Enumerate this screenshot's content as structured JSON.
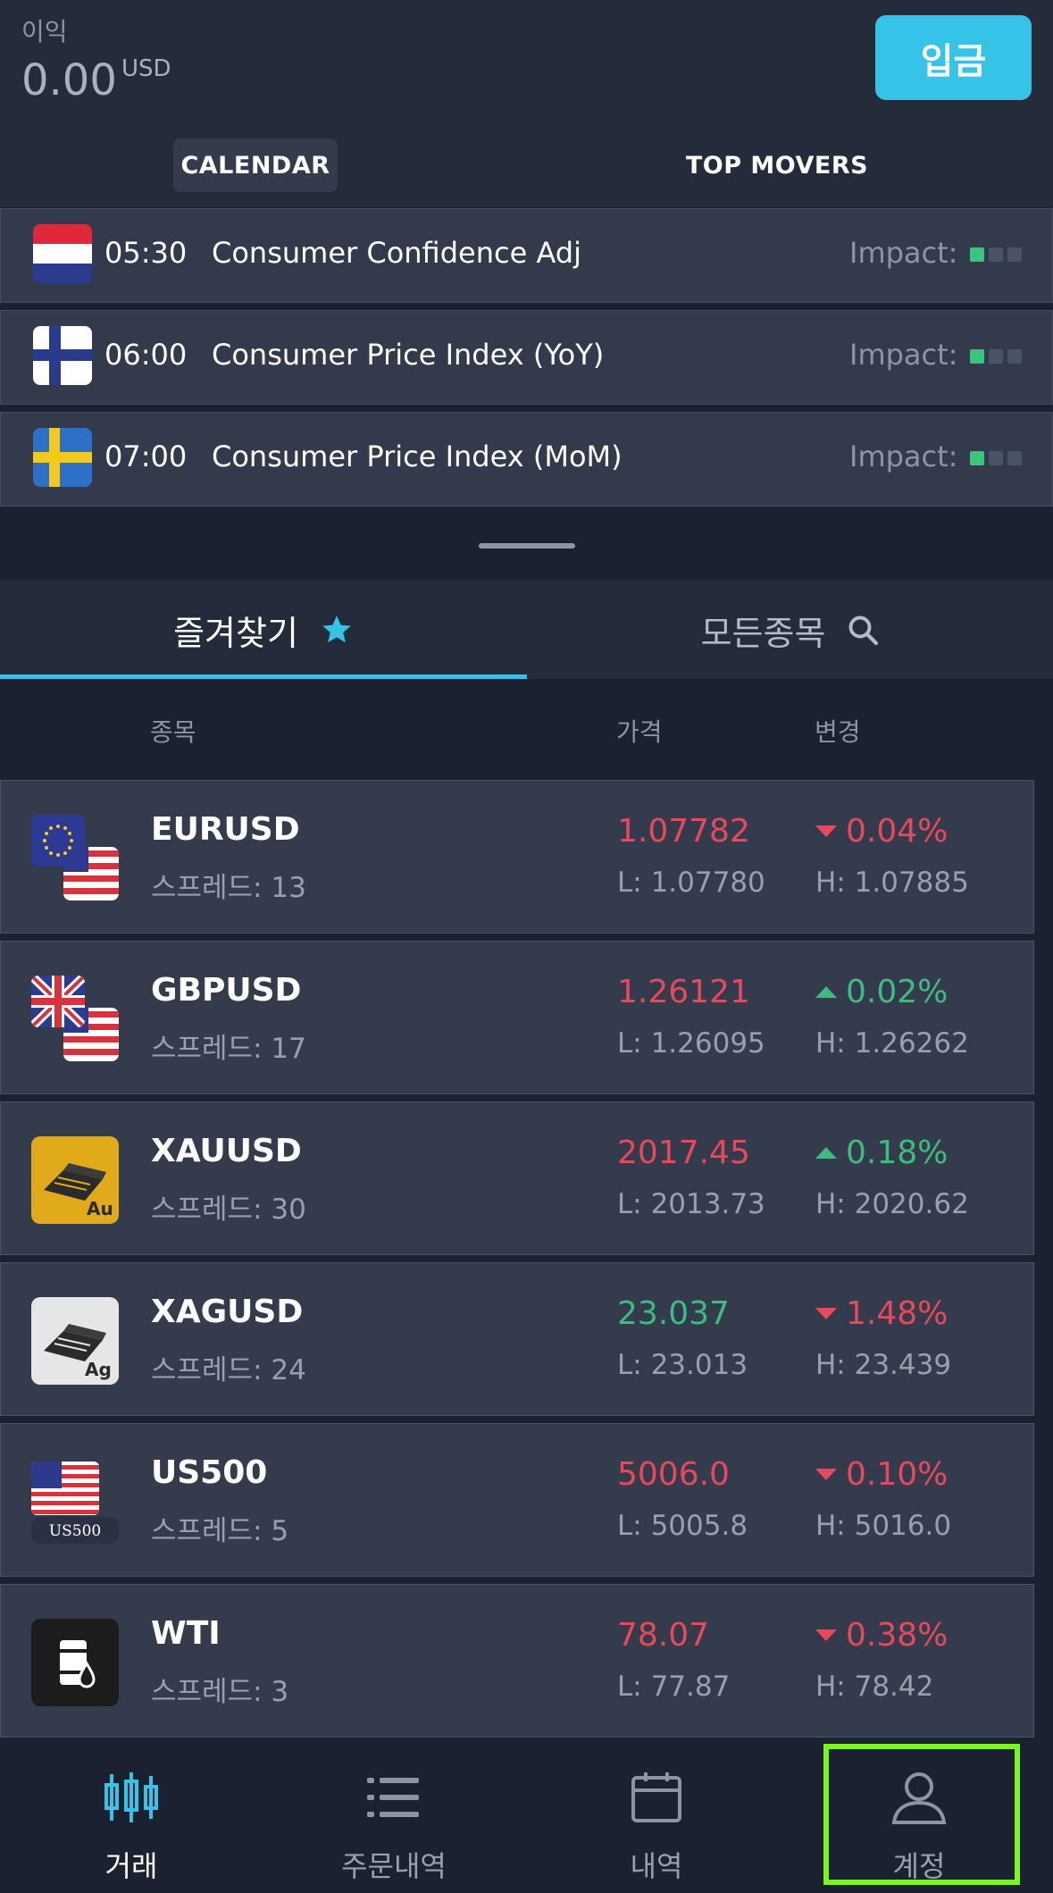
{
  "header": {
    "profit_label": "이익",
    "profit_value": "0.00",
    "profit_currency": "USD",
    "deposit_label": "입금"
  },
  "calendar_tabs": [
    {
      "label": "CALENDAR",
      "active": true
    },
    {
      "label": "TOP MOVERS",
      "active": false
    }
  ],
  "calendar_events": [
    {
      "time": "05:30",
      "event": "Consumer Confidence Adj",
      "impact_label": "Impact:",
      "impact_level": 1,
      "flag": "netherlands-flag-icon"
    },
    {
      "time": "06:00",
      "event": "Consumer Price Index (YoY)",
      "impact_label": "Impact:",
      "impact_level": 1,
      "flag": "finland-flag-icon"
    },
    {
      "time": "07:00",
      "event": "Consumer Price Index (MoM)",
      "impact_label": "Impact:",
      "impact_level": 1,
      "flag": "sweden-flag-icon"
    }
  ],
  "section_tabs": {
    "favorites": "즐겨찾기",
    "all_symbols": "모든종목"
  },
  "columns": {
    "symbol": "종목",
    "price": "가격",
    "change": "변경"
  },
  "instruments": [
    {
      "symbol": "EURUSD",
      "spread": "스프레드: 13",
      "price": "1.07782",
      "price_color": "red",
      "low": "L: 1.07780",
      "change": "0.04%",
      "direction": "down",
      "high": "H: 1.07885",
      "icon": "eur-usd-flag-icon"
    },
    {
      "symbol": "GBPUSD",
      "spread": "스프레드: 17",
      "price": "1.26121",
      "price_color": "red",
      "low": "L: 1.26095",
      "change": "0.02%",
      "direction": "up",
      "high": "H: 1.26262",
      "icon": "gbp-usd-flag-icon"
    },
    {
      "symbol": "XAUUSD",
      "spread": "스프레드: 30",
      "price": "2017.45",
      "price_color": "red",
      "low": "L: 2013.73",
      "change": "0.18%",
      "direction": "up",
      "high": "H: 2020.62",
      "icon": "gold-bar-icon",
      "icon_text": "Au"
    },
    {
      "symbol": "XAGUSD",
      "spread": "스프레드: 24",
      "price": "23.037",
      "price_color": "green",
      "low": "L: 23.013",
      "change": "1.48%",
      "direction": "down",
      "high": "H: 23.439",
      "icon": "silver-bar-icon",
      "icon_text": "Ag"
    },
    {
      "symbol": "US500",
      "spread": "스프레드: 5",
      "price": "5006.0",
      "price_color": "red",
      "low": "L: 5005.8",
      "change": "0.10%",
      "direction": "down",
      "high": "H: 5016.0",
      "icon": "us500-index-icon",
      "icon_text": "US500"
    },
    {
      "symbol": "WTI",
      "spread": "스프레드: 3",
      "price": "78.07",
      "price_color": "red",
      "low": "L: 77.87",
      "change": "0.38%",
      "direction": "down",
      "high": "H: 78.42",
      "icon": "oil-barrel-icon"
    }
  ],
  "bottom_nav": [
    {
      "label": "거래",
      "icon": "candlestick-icon",
      "active": true
    },
    {
      "label": "주문내역",
      "icon": "list-icon",
      "active": false
    },
    {
      "label": "내역",
      "icon": "calendar-icon",
      "active": false
    },
    {
      "label": "계정",
      "icon": "user-icon",
      "active": false
    }
  ],
  "colors": {
    "accent": "#35c3e8",
    "up": "#3dbc7e",
    "down": "#e8495a",
    "highlight": "#7cf521"
  }
}
